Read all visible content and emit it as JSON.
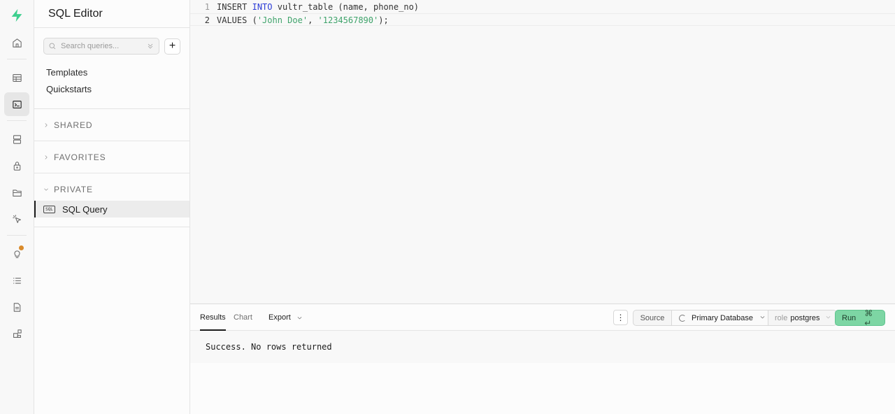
{
  "sidebar": {
    "title": "SQL Editor",
    "search_placeholder": "Search queries...",
    "add_label": "+",
    "links": [
      "Templates",
      "Quickstarts"
    ],
    "sections": {
      "shared": "SHARED",
      "favorites": "FAVORITES",
      "private": "PRIVATE"
    },
    "query_icon_text": "SQL",
    "active_query": "SQL Query"
  },
  "editor": {
    "line_numbers": [
      "1",
      "2"
    ],
    "line1": {
      "kw1": "INSERT",
      "kw2": "INTO",
      "rest": " vultr_table (name, phone_no)"
    },
    "line2": {
      "kw": "VALUES",
      "open": " (",
      "str1": "'John Doe'",
      "sep": ", ",
      "str2": "'1234567890'",
      "close": ");"
    }
  },
  "results": {
    "tabs": [
      "Results",
      "Chart"
    ],
    "export_label": "Export",
    "dots_label": "⋮",
    "source_label": "Source",
    "database_label": "Primary Database",
    "role_prefix": "role",
    "role_value": "postgres",
    "run_label": "Run",
    "run_shortcut": "⌘ ↵",
    "message": "Success. No rows returned"
  },
  "colors": {
    "accent_green": "#7dd6a4",
    "keyword_blue": "#2b3bd6",
    "string_green": "#3fa36b",
    "notification_dot": "#d98a2b"
  },
  "rail_icons": [
    "logo-bolt-icon",
    "home-icon",
    "table-icon",
    "terminal-icon",
    "database-icon",
    "lock-icon",
    "folder-icon",
    "cursor-icon",
    "lightbulb-icon",
    "list-icon",
    "document-icon",
    "extensions-icon"
  ]
}
